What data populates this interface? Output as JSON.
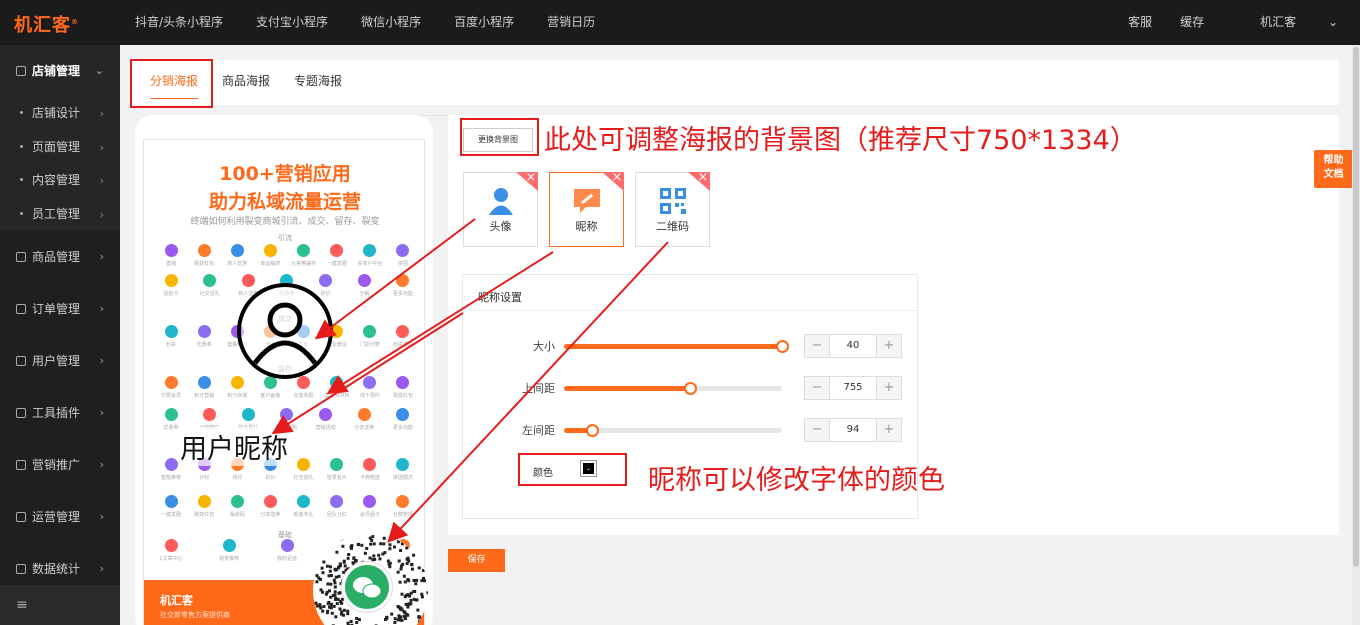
{
  "app": {
    "logo": "机汇客"
  },
  "topnav": {
    "items": [
      "抖音/头条小程序",
      "支付宝小程序",
      "微信小程序",
      "百度小程序",
      "营销日历"
    ]
  },
  "topright": {
    "items": [
      "客服",
      "缓存",
      "机汇客"
    ]
  },
  "sidebar": {
    "groups": [
      {
        "label": "店铺管理",
        "expanded": true,
        "children": [
          "店铺设计",
          "页面管理",
          "内容管理",
          "员工管理"
        ]
      },
      {
        "label": "商品管理"
      },
      {
        "label": "订单管理"
      },
      {
        "label": "用户管理"
      },
      {
        "label": "工具插件"
      },
      {
        "label": "营销推广"
      },
      {
        "label": "运营管理"
      },
      {
        "label": "数据统计"
      }
    ],
    "collapse_icon": "≡"
  },
  "tabs": [
    "分销海报",
    "商品海报",
    "专题海报"
  ],
  "active_tab": "分销海报",
  "poster": {
    "title_line1": "100+营销应用",
    "title_line2": "助力私域流量运营",
    "subtitle": "终端如何利用裂变商城引流、成交、留存、裂变",
    "sections": [
      "引流",
      "成交",
      "留存",
      "基础"
    ],
    "icon_labels": [
      [
        "直播",
        "裂变红包",
        "新人优惠",
        "幸运抽奖",
        "九宫格抽奖",
        "一键发圈",
        "多商户平台",
        "拼团"
      ],
      [
        "刮刮卡",
        "社交送礼",
        "新人送券",
        "优惠券",
        "砍价",
        "分销",
        "更多功能"
      ],
      [
        "秒杀",
        "优惠券",
        "套餐组合",
        "满减",
        "签到",
        "企业微信",
        "门店列表",
        "秒杀活动"
      ],
      [
        "付费会员",
        "积分营销",
        "积分商城",
        "客户画像",
        "充值奖励",
        "营销SCRM",
        "线下预约",
        "裂变红包"
      ],
      [
        "优惠券",
        "分销推广",
        "新会员礼",
        "社区团购",
        "营销活动",
        "分享送券",
        "更多功能"
      ],
      [
        "智能推荐",
        "计时",
        "测评",
        "砍价",
        "社交送礼",
        "智慧名片",
        "卡券赠送",
        "拼团模式"
      ],
      [
        "一键发圈",
        "裂变红包",
        "渠道码",
        "分享送券",
        "新客专礼",
        "团队分红",
        "会员圈子",
        "社群管理"
      ],
      [
        "1文章中心",
        "裂变推荐",
        "我的足迹",
        "消费记录",
        "积分明细"
      ]
    ],
    "footer_name": "机汇客",
    "footer_sub": "社交新零售方案提供商",
    "overlay_nickname": "用户昵称"
  },
  "editor": {
    "change_bg_button": "更换背景图",
    "annotation_bg": "此处可调整海报的背景图（推荐尺寸750*1334）",
    "annotation_color": "昵称可以修改字体的颜色",
    "elements": [
      {
        "label": "头像",
        "icon": "avatar-icon"
      },
      {
        "label": "昵称",
        "icon": "nickname-icon"
      },
      {
        "label": "二维码",
        "icon": "qrcode-icon"
      }
    ],
    "delete_icon": "×",
    "settings_title": "昵称设置",
    "rows": [
      {
        "label": "大小",
        "value": "40",
        "fraction": 1.0
      },
      {
        "label": "上间距",
        "value": "755",
        "fraction": 0.58
      },
      {
        "label": "左间距",
        "value": "94",
        "fraction": 0.13
      }
    ],
    "minus": "−",
    "plus": "+",
    "color_label": "颜色",
    "color_value": "#000000",
    "save_button": "保存"
  },
  "help": {
    "line1": "帮助",
    "line2": "文档"
  },
  "colors": {
    "accent": "#ff6a1a",
    "annotation": "#e61c1c",
    "topbar": "#1b1b1b",
    "sidebar": "#1f1f1f"
  }
}
